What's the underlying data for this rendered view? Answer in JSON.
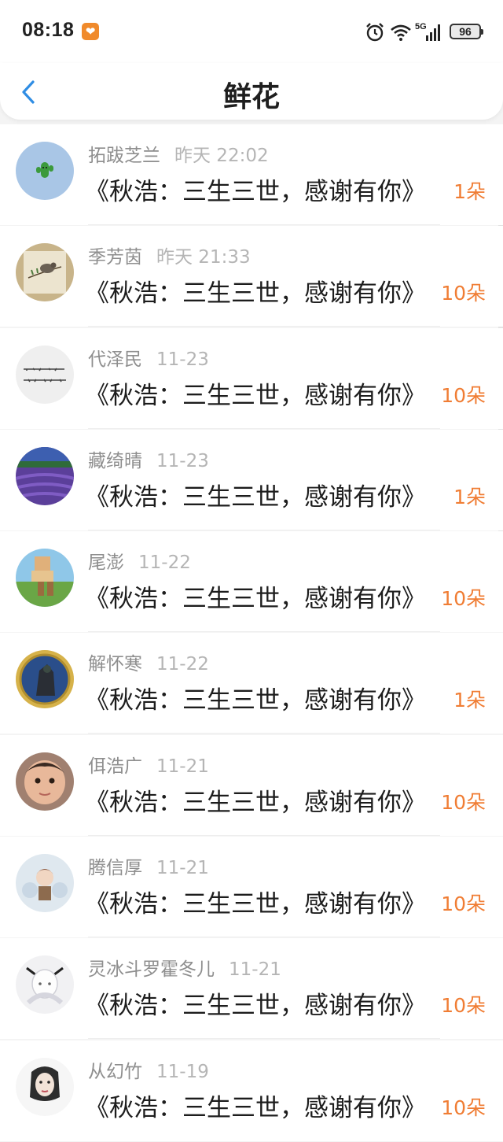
{
  "status": {
    "time": "08:18",
    "app_icon": "taobao-badge-icon",
    "battery": "96",
    "network": "5G"
  },
  "header": {
    "title": "鲜花",
    "back_icon": "chevron-left-icon"
  },
  "colors": {
    "accent_orange": "#f07d34",
    "back_blue": "#2f8de4"
  },
  "items": [
    {
      "name": "拓跋芝兰",
      "date": "昨天 22:02",
      "book": "《秋浩：三生三世，感谢有你》",
      "count": "1朵",
      "avatar": "cactus-avatar"
    },
    {
      "name": "季芳茵",
      "date": "昨天 21:33",
      "book": "《秋浩：三生三世，感谢有你》",
      "count": "10朵",
      "avatar": "bird-painting-avatar"
    },
    {
      "name": "代泽民",
      "date": "11-23",
      "book": "《秋浩：三生三世，感谢有你》",
      "count": "10朵",
      "avatar": "calligraphy-avatar"
    },
    {
      "name": "藏绮晴",
      "date": "11-23",
      "book": "《秋浩：三生三世，感谢有你》",
      "count": "1朵",
      "avatar": "lavender-avatar"
    },
    {
      "name": "尾澎",
      "date": "11-22",
      "book": "《秋浩：三生三世，感谢有你》",
      "count": "10朵",
      "avatar": "blocky-avatar"
    },
    {
      "name": "解怀寒",
      "date": "11-22",
      "book": "《秋浩：三生三世，感谢有你》",
      "count": "1朵",
      "avatar": "badge-avatar"
    },
    {
      "name": "佴浩广",
      "date": "11-21",
      "book": "《秋浩：三生三世，感谢有你》",
      "count": "10朵",
      "avatar": "baby-avatar"
    },
    {
      "name": "腾信厚",
      "date": "11-21",
      "book": "《秋浩：三生三世，感谢有你》",
      "count": "10朵",
      "avatar": "anime-doll-avatar"
    },
    {
      "name": "灵冰斗罗霍冬儿",
      "date": "11-21",
      "book": "《秋浩：三生三世，感谢有你》",
      "count": "10朵",
      "avatar": "white-hair-avatar"
    },
    {
      "name": "从幻竹",
      "date": "11-19",
      "book": "《秋浩：三生三世，感谢有你》",
      "count": "10朵",
      "avatar": "sketch-girl-avatar"
    }
  ]
}
